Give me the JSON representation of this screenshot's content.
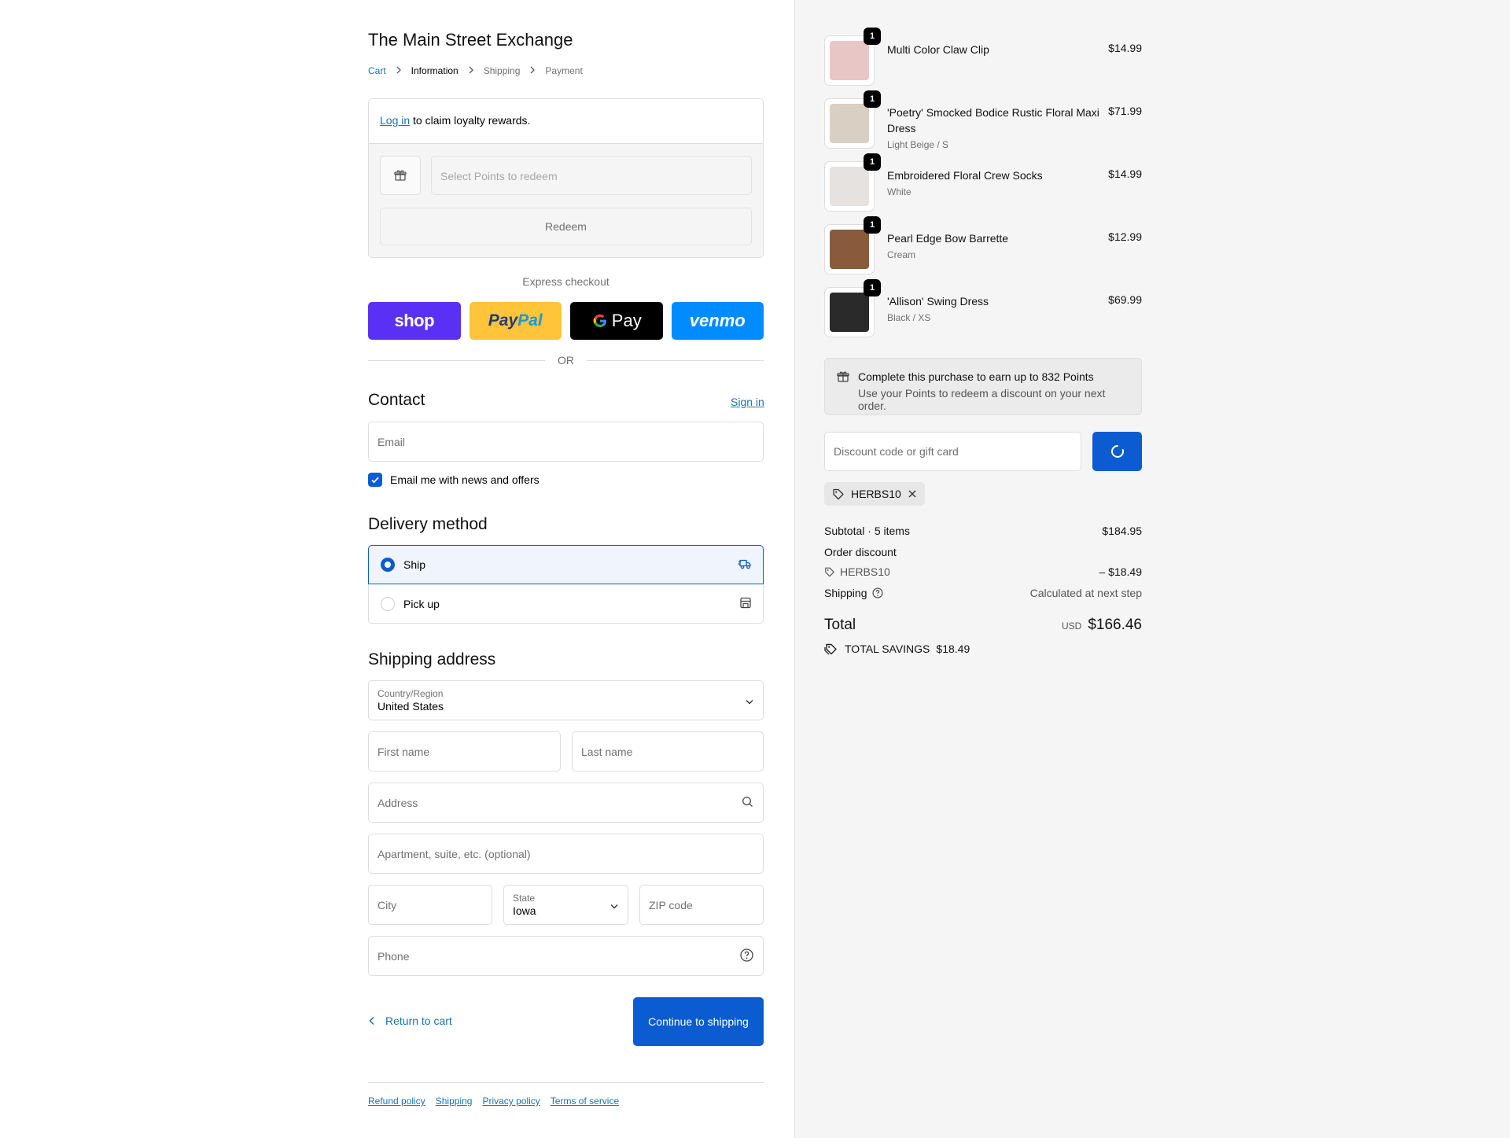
{
  "store": {
    "name": "The Main Street Exchange"
  },
  "breadcrumb": {
    "cart": "Cart",
    "information": "Information",
    "shipping": "Shipping",
    "payment": "Payment"
  },
  "loyalty": {
    "login_link": "Log in",
    "login_text": " to claim loyalty rewards.",
    "points_placeholder": "Select Points to redeem",
    "redeem_label": "Redeem"
  },
  "express": {
    "label": "Express checkout",
    "shop": "shop",
    "paypal_1": "Pay",
    "paypal_2": "Pal",
    "gpay": "Pay",
    "venmo": "venmo",
    "or": "OR"
  },
  "contact": {
    "heading": "Contact",
    "sign_in": "Sign in",
    "email_placeholder": "Email",
    "newsletter_label": "Email me with news and offers",
    "newsletter_checked": true
  },
  "delivery": {
    "heading": "Delivery method",
    "ship": "Ship",
    "pickup": "Pick up",
    "selected": "ship"
  },
  "shipping_address": {
    "heading": "Shipping address",
    "country_label": "Country/Region",
    "country_value": "United States",
    "first_name": "First name",
    "last_name": "Last name",
    "address": "Address",
    "apartment": "Apartment, suite, etc. (optional)",
    "city": "City",
    "state_label": "State",
    "state_value": "Iowa",
    "zip": "ZIP code",
    "phone": "Phone"
  },
  "actions": {
    "return": "Return to cart",
    "continue": "Continue to shipping"
  },
  "footer": {
    "refund": "Refund policy",
    "shipping": "Shipping",
    "privacy": "Privacy policy",
    "terms": "Terms of service"
  },
  "items": [
    {
      "name": "Multi Color Claw Clip",
      "variant": "",
      "price": "$14.99",
      "qty": "1",
      "color": "#e9c6c6"
    },
    {
      "name": "'Poetry' Smocked Bodice Rustic Floral Maxi Dress",
      "variant": "Light Beige / S",
      "price": "$71.99",
      "qty": "1",
      "color": "#d9cfc3"
    },
    {
      "name": "Embroidered Floral Crew Socks",
      "variant": "White",
      "price": "$14.99",
      "qty": "1",
      "color": "#e6e2df"
    },
    {
      "name": "Pearl Edge Bow Barrette",
      "variant": "Cream",
      "price": "$12.99",
      "qty": "1",
      "color": "#8a5a3c"
    },
    {
      "name": "'Allison' Swing Dress",
      "variant": "Black / XS",
      "price": "$69.99",
      "qty": "1",
      "color": "#2a2a2a"
    }
  ],
  "points": {
    "earn": "Complete this purchase to earn up to 832 Points",
    "note": "Use your Points to redeem a discount on your next order."
  },
  "discount": {
    "placeholder": "Discount code or gift card",
    "code": "HERBS10"
  },
  "summary": {
    "subtotal_label": "Subtotal · 5 items",
    "subtotal": "$184.95",
    "order_discount_label": "Order discount",
    "discount_code": "HERBS10",
    "discount_amount": "– $18.49",
    "shipping_label": "Shipping",
    "shipping_value": "Calculated at next step",
    "total_label": "Total",
    "currency": "USD",
    "total": "$166.46",
    "savings_label": "TOTAL SAVINGS",
    "savings": "$18.49"
  },
  "colors": {
    "accent": "#0b5cd0",
    "link": "#1773b0",
    "shop": "#5a31f4",
    "paypal": "#ffc439",
    "venmo": "#008cff"
  }
}
